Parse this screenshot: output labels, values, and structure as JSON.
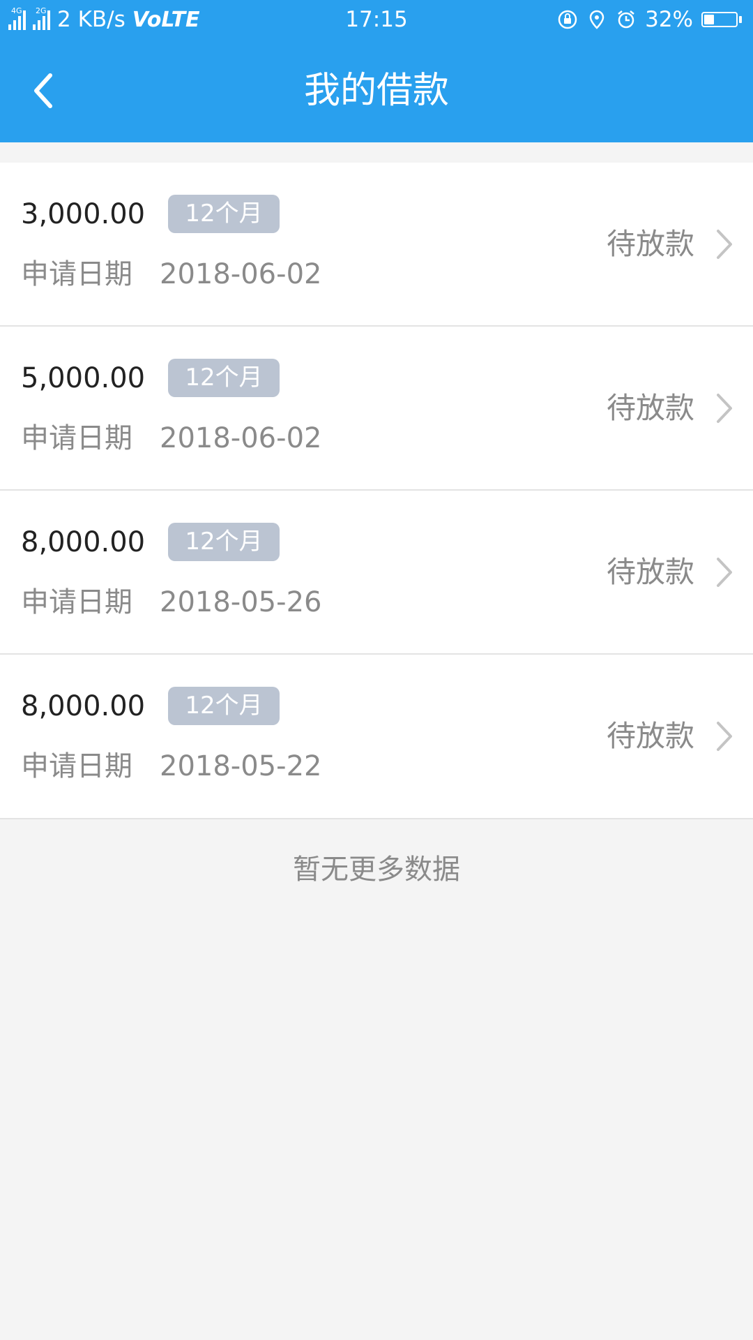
{
  "status_bar": {
    "network_4g": "4G",
    "network_2g": "2G",
    "speed": "2 KB/s",
    "volte": "VoLTE",
    "time": "17:15",
    "battery": "32%",
    "icons": [
      "rotation-lock-icon",
      "location-icon",
      "alarm-icon",
      "battery-icon"
    ]
  },
  "header": {
    "title": "我的借款",
    "back_icon": "chevron-left-icon"
  },
  "loans": [
    {
      "amount": "3,000.00",
      "term": "12个月",
      "date_label": "申请日期",
      "date": "2018-06-02",
      "status": "待放款"
    },
    {
      "amount": "5,000.00",
      "term": "12个月",
      "date_label": "申请日期",
      "date": "2018-06-02",
      "status": "待放款"
    },
    {
      "amount": "8,000.00",
      "term": "12个月",
      "date_label": "申请日期",
      "date": "2018-05-26",
      "status": "待放款"
    },
    {
      "amount": "8,000.00",
      "term": "12个月",
      "date_label": "申请日期",
      "date": "2018-05-22",
      "status": "待放款"
    }
  ],
  "footer": {
    "no_more": "暂无更多数据"
  },
  "colors": {
    "primary": "#29a0ee",
    "badge": "#bbc4d2",
    "muted_text": "#8a8a8a",
    "background": "#f4f4f4"
  }
}
